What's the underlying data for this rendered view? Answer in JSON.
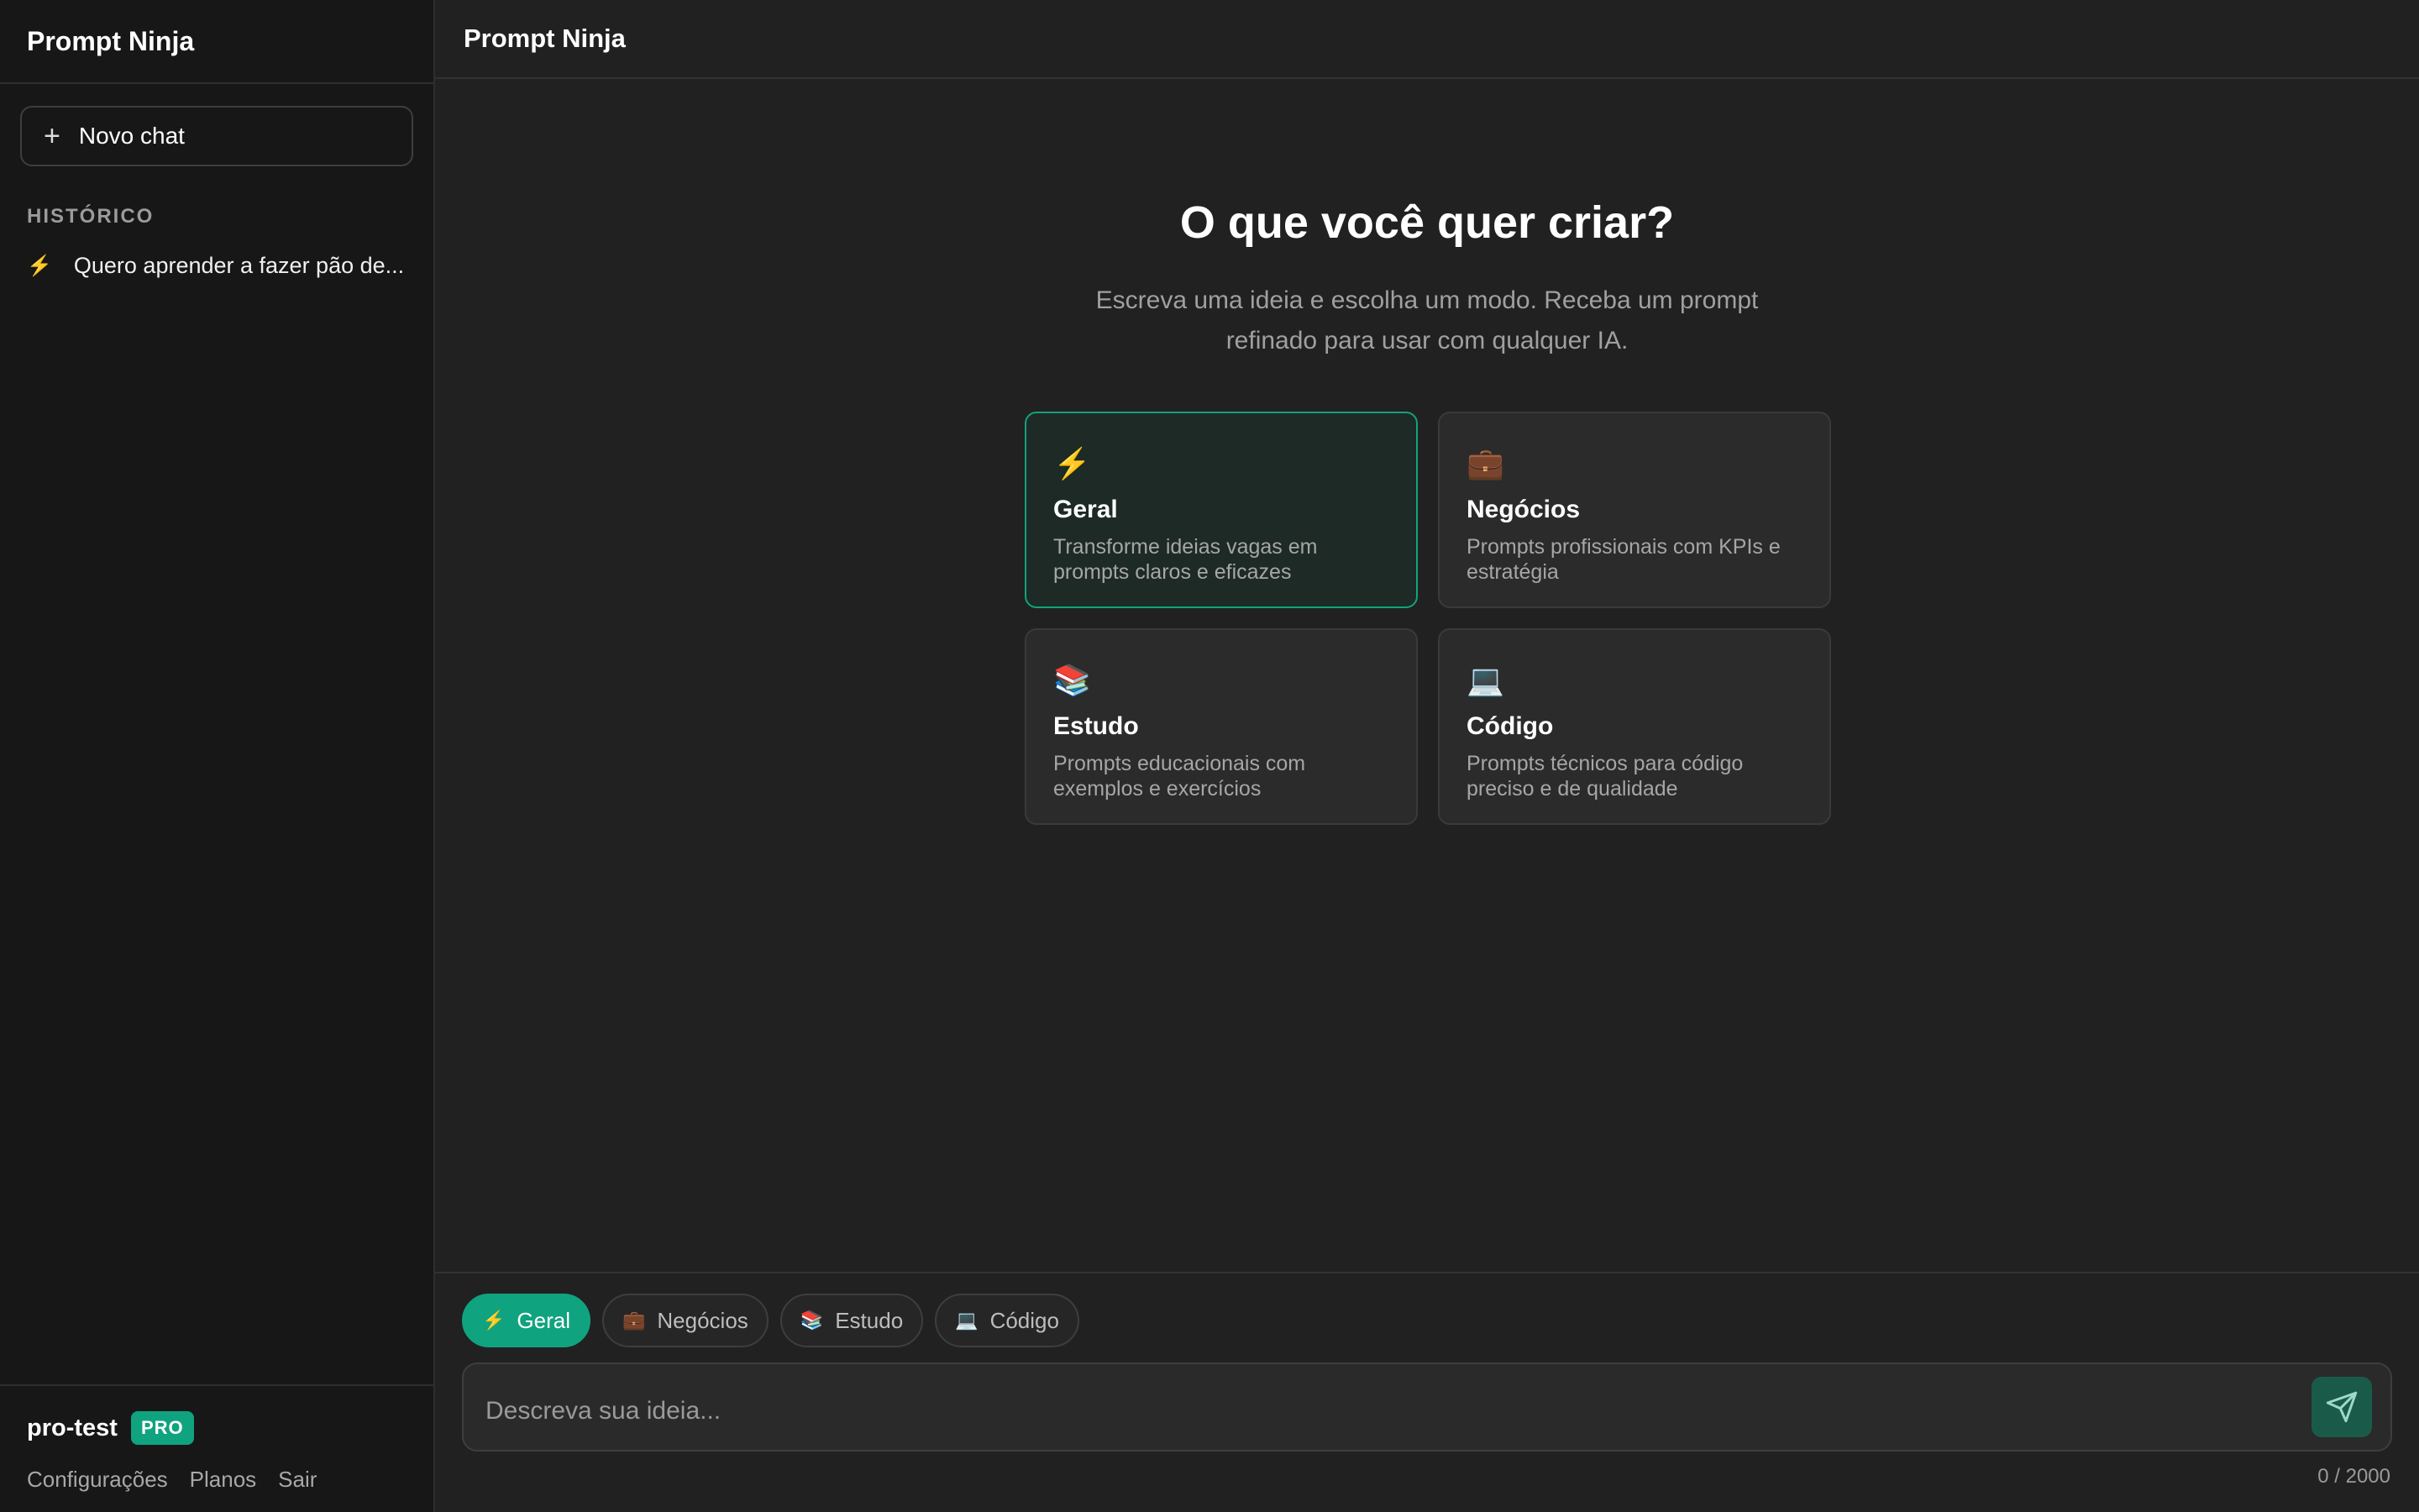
{
  "sidebar": {
    "app_title": "Prompt Ninja",
    "new_chat_label": "Novo chat",
    "history_title": "HISTÓRICO",
    "history": [
      {
        "icon": "bolt-icon",
        "label": "Quero aprender a fazer pão de..."
      }
    ],
    "user": {
      "name": "pro-test",
      "badge": "PRO"
    },
    "links": [
      "Configurações",
      "Planos",
      "Sair"
    ]
  },
  "header": {
    "title": "Prompt Ninja"
  },
  "hero": {
    "title": "O que você quer criar?",
    "subtitle": "Escreva uma ideia e escolha um modo. Receba um prompt refinado para usar com qualquer IA."
  },
  "modes": [
    {
      "icon": "⚡",
      "title": "Geral",
      "description": "Transforme ideias vagas em prompts claros e eficazes",
      "selected": true
    },
    {
      "icon": "💼",
      "title": "Negócios",
      "description": "Prompts profissionais com KPIs e estratégia",
      "selected": false
    },
    {
      "icon": "📚",
      "title": "Estudo",
      "description": "Prompts educacionais com exemplos e exercícios",
      "selected": false
    },
    {
      "icon": "💻",
      "title": "Código",
      "description": "Prompts técnicos para código preciso e de qualidade",
      "selected": false
    }
  ],
  "composer": {
    "chips": [
      {
        "icon": "⚡",
        "label": "Geral",
        "active": true
      },
      {
        "icon": "💼",
        "label": "Negócios",
        "active": false
      },
      {
        "icon": "📚",
        "label": "Estudo",
        "active": false
      },
      {
        "icon": "💻",
        "label": "Código",
        "active": false
      }
    ],
    "placeholder": "Descreva sua ideia...",
    "value": "",
    "counter": "0 / 2000"
  },
  "colors": {
    "accent": "#10a37f",
    "background": "#212121",
    "sidebar": "#171717"
  }
}
